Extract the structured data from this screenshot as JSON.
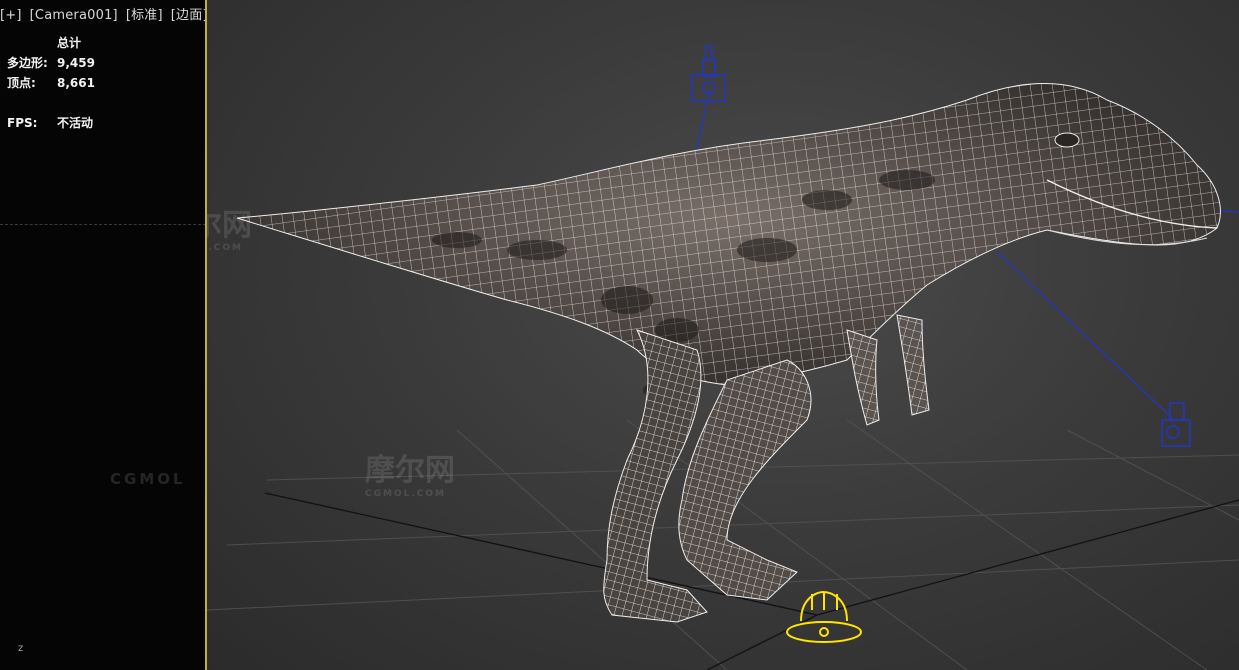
{
  "viewport_label": {
    "plus": "[+]",
    "camera": "[Camera001]",
    "shading": "[标准]",
    "mode": "[边面]"
  },
  "stats": {
    "title": "总计",
    "polygons_label": "多边形:",
    "polygons_value": "9,459",
    "vertices_label": "顶点:",
    "vertices_value": "8,661",
    "fps_label": "FPS:",
    "fps_value": "不活动"
  },
  "watermarks": {
    "brand": "摩尔网",
    "domain": "CGMOL.COM",
    "left_strip": "CGMOL"
  },
  "axis_gizmo": {
    "z_label": "z"
  },
  "colors": {
    "active_viewport_border": "#c9b02a",
    "viewport_bg": "#3b3b3b",
    "wire": "#ffffff",
    "light_helper": "#1a2fd0",
    "selected_helper": "#ffe400"
  },
  "icons": [
    "camera-icon",
    "spotlight-icon",
    "omni-light-icon",
    "axis-gizmo-icon"
  ]
}
